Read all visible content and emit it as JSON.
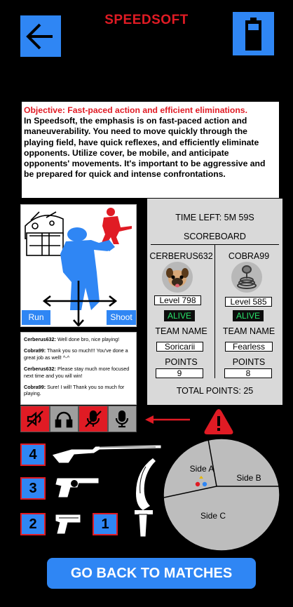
{
  "header": {
    "title": "SPEEDSOFT",
    "back_icon": "arrow-left-icon",
    "battery_icon": "battery-icon"
  },
  "objective": {
    "title": "Objective: Fast-paced action and efficient eliminations.",
    "body": "In Speedsoft, the emphasis is on fast-paced action and maneuverability. You need to move quickly through the playing field, have quick reflexes, and efficiently eliminate opponents. Utilize cover, be mobile, and anticipate opponents' movements. It's important to be aggressive and be prepared for quick and intense confrontations."
  },
  "controls": {
    "run_label": "Run",
    "shoot_label": "Shoot"
  },
  "chat": {
    "messages": [
      {
        "user": "Cerberus632:",
        "text": " Well done bro, nice playing!"
      },
      {
        "user": "Cobra99:",
        "text": " Thank you so much!!! You've done a great job as well! ^-^"
      },
      {
        "user": "Cerberus632:",
        "text": " Please stay much more focused  next time and you will win!"
      },
      {
        "user": "Cobra99:",
        "text": " Sure! I will! Thank you so much for playing."
      }
    ]
  },
  "voice": {
    "icons": [
      "volume-muted-icon",
      "headphones-icon",
      "mic-muted-icon",
      "microphone-icon"
    ],
    "colors": [
      "#e01b24",
      "#9e9e9e",
      "#e01b24",
      "#9e9e9e"
    ]
  },
  "scoreboard": {
    "time_left": "TIME LEFT: 5M 59S",
    "title": "SCOREBOARD",
    "team_name_label": "TEAM NAME",
    "points_label": "POINTS",
    "total_points": "TOTAL POINTS: 25",
    "players": [
      {
        "name": "CERBERUS632",
        "level": "Level 798",
        "status": "ALIVE",
        "team": "Soricarii",
        "points": "9",
        "avatar": "pug-avatar-icon"
      },
      {
        "name": "COBRA99",
        "level": "Level 585",
        "status": "ALIVE",
        "team": "Fearless",
        "points": "8",
        "avatar": "cobra-avatar-icon"
      }
    ]
  },
  "weapons": {
    "slots": [
      "4",
      "3",
      "2",
      "1"
    ],
    "icons": [
      "rifle-icon",
      "revolver-icon",
      "pistol-icon",
      "knife-icon"
    ]
  },
  "map": {
    "sides": [
      "Side A",
      "Side B",
      "Side C"
    ]
  },
  "actions": {
    "back_to_matches": "GO BACK TO MATCHES"
  },
  "colors": {
    "accent": "#2f86f4",
    "danger": "#e01b24",
    "alive": "#29e36a"
  }
}
